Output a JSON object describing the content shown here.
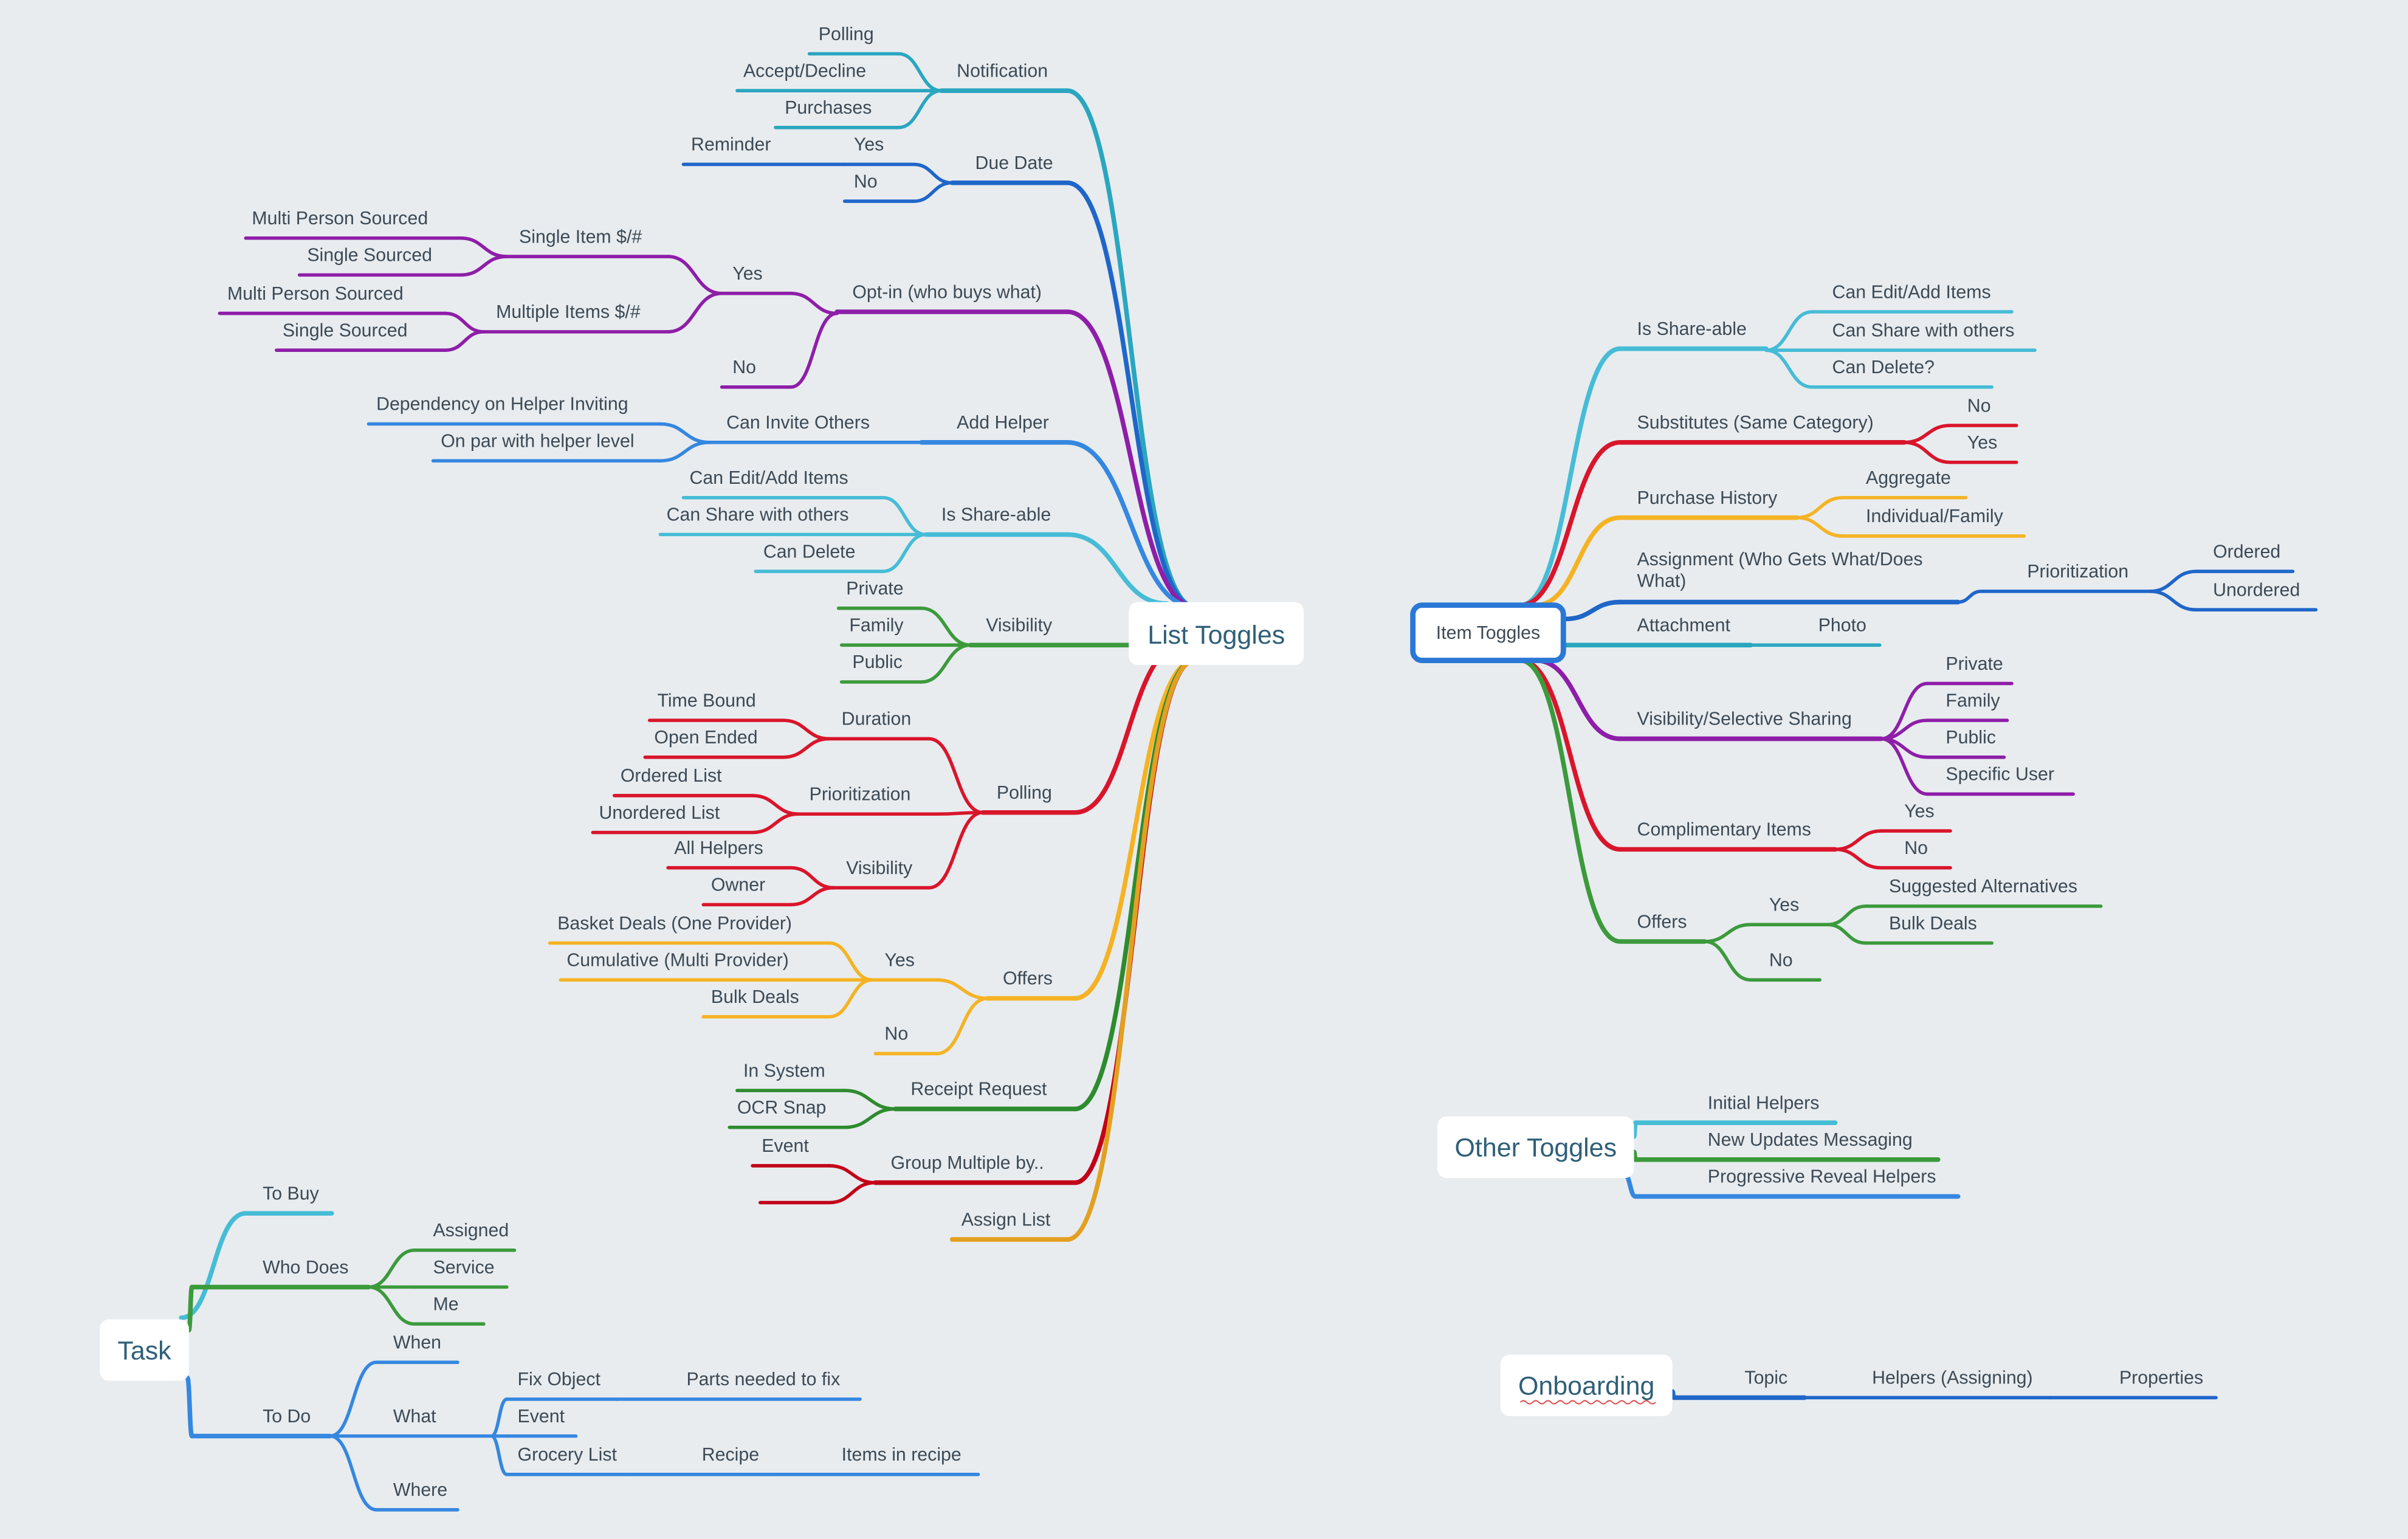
{
  "colors": {
    "background": "#e8ecef",
    "teal": "#2aa6bf",
    "dblue": "#1f66c9",
    "purple": "#8e1ea8",
    "blue": "#3587e0",
    "cyan": "#46bcd6",
    "green": "#3c9a3c",
    "red": "#d9152b",
    "yellow": "#f5b324",
    "dgreen": "#2e8b2e",
    "dred": "#c20018",
    "orange": "#e3a020",
    "item_toggles_border": "#2a78d6"
  },
  "list_toggles": {
    "root": "List Toggles",
    "notification": "Notification",
    "n_polling": "Polling",
    "n_accept": "Accept/Decline",
    "n_purchases": "Purchases",
    "due_date": "Due Date",
    "dd_yes": "Yes",
    "dd_reminder": "Reminder",
    "dd_no": "No",
    "optin": "Opt-in (who buys what)",
    "oi_yes": "Yes",
    "oi_no": "No",
    "oi_single": "Single Item $/#",
    "oi_multiple": "Multiple Items $/#",
    "oi_s_multi": "Multi Person Sourced",
    "oi_s_single": "Single Sourced",
    "oi_m_multi": "Multi Person Sourced",
    "oi_m_single": "Single Sourced",
    "add_helper": "Add Helper",
    "ah_invite": "Can Invite Others",
    "ah_dep": "Dependency on Helper Inviting",
    "ah_par": "On par with helper level",
    "share": "Is Share-able",
    "sh_edit": "Can Edit/Add Items",
    "sh_share": "Can Share with others",
    "sh_delete": "Can Delete",
    "visibility": "Visibility",
    "v_private": "Private",
    "v_family": "Family",
    "v_public": "Public",
    "polling": "Polling",
    "p_duration": "Duration",
    "p_prior": "Prioritization",
    "p_vis": "Visibility",
    "p_time": "Time Bound",
    "p_open": "Open Ended",
    "p_ordered": "Ordered List",
    "p_unordered": "Unordered List",
    "p_all": "All Helpers",
    "p_owner": "Owner",
    "offers": "Offers",
    "o_yes": "Yes",
    "o_no": "No",
    "o_basket": "Basket Deals (One Provider)",
    "o_cum": "Cumulative (Multi Provider)",
    "o_bulk": "Bulk Deals",
    "receipt": "Receipt Request",
    "r_in": "In System",
    "r_ocr": "OCR Snap",
    "group": "Group Multiple by..",
    "g_event": "Event",
    "g_blank": "",
    "assign": "Assign List"
  },
  "item_toggles": {
    "root": "Item Toggles",
    "share": "Is Share-able",
    "s_edit": "Can Edit/Add Items",
    "s_share": "Can Share with others",
    "s_delete": "Can Delete?",
    "subs": "Substitutes (Same Category)",
    "su_no": "No",
    "su_yes": "Yes",
    "purchase": "Purchase History",
    "pu_agg": "Aggregate",
    "pu_indiv": "Individual/Family",
    "assignment": "Assignment (Who Gets What/Does What)",
    "as_prior": "Prioritization",
    "as_ordered": "Ordered",
    "as_unordered": "Unordered",
    "attachment": "Attachment",
    "at_photo": "Photo",
    "vis": "Visibility/Selective Sharing",
    "vi_private": "Private",
    "vi_family": "Family",
    "vi_public": "Public",
    "vi_specific": "Specific User",
    "comp": "Complimentary Items",
    "co_yes": "Yes",
    "co_no": "No",
    "offers": "Offers",
    "of_yes": "Yes",
    "of_no": "No",
    "of_sugg": "Suggested Alternatives",
    "of_bulk": "Bulk Deals"
  },
  "other_toggles": {
    "root": "Other Toggles",
    "initial": "Initial Helpers",
    "new_updates": "New Updates Messaging",
    "progressive": "Progressive Reveal Helpers"
  },
  "onboarding": {
    "root": "Onboarding",
    "topic": "Topic",
    "helpers": "Helpers (Assigning)",
    "properties": "Properties"
  },
  "task": {
    "root": "Task",
    "to_buy": "To Buy",
    "who_does": "Who Does",
    "assigned": "Assigned",
    "service": "Service",
    "me": "Me",
    "to_do": "To Do",
    "when": "When",
    "what": "What",
    "where": "Where",
    "fix": "Fix Object",
    "parts": "Parts needed to fix",
    "event": "Event",
    "grocery": "Grocery List",
    "recipe": "Recipe",
    "items_recipe": "Items in recipe"
  }
}
